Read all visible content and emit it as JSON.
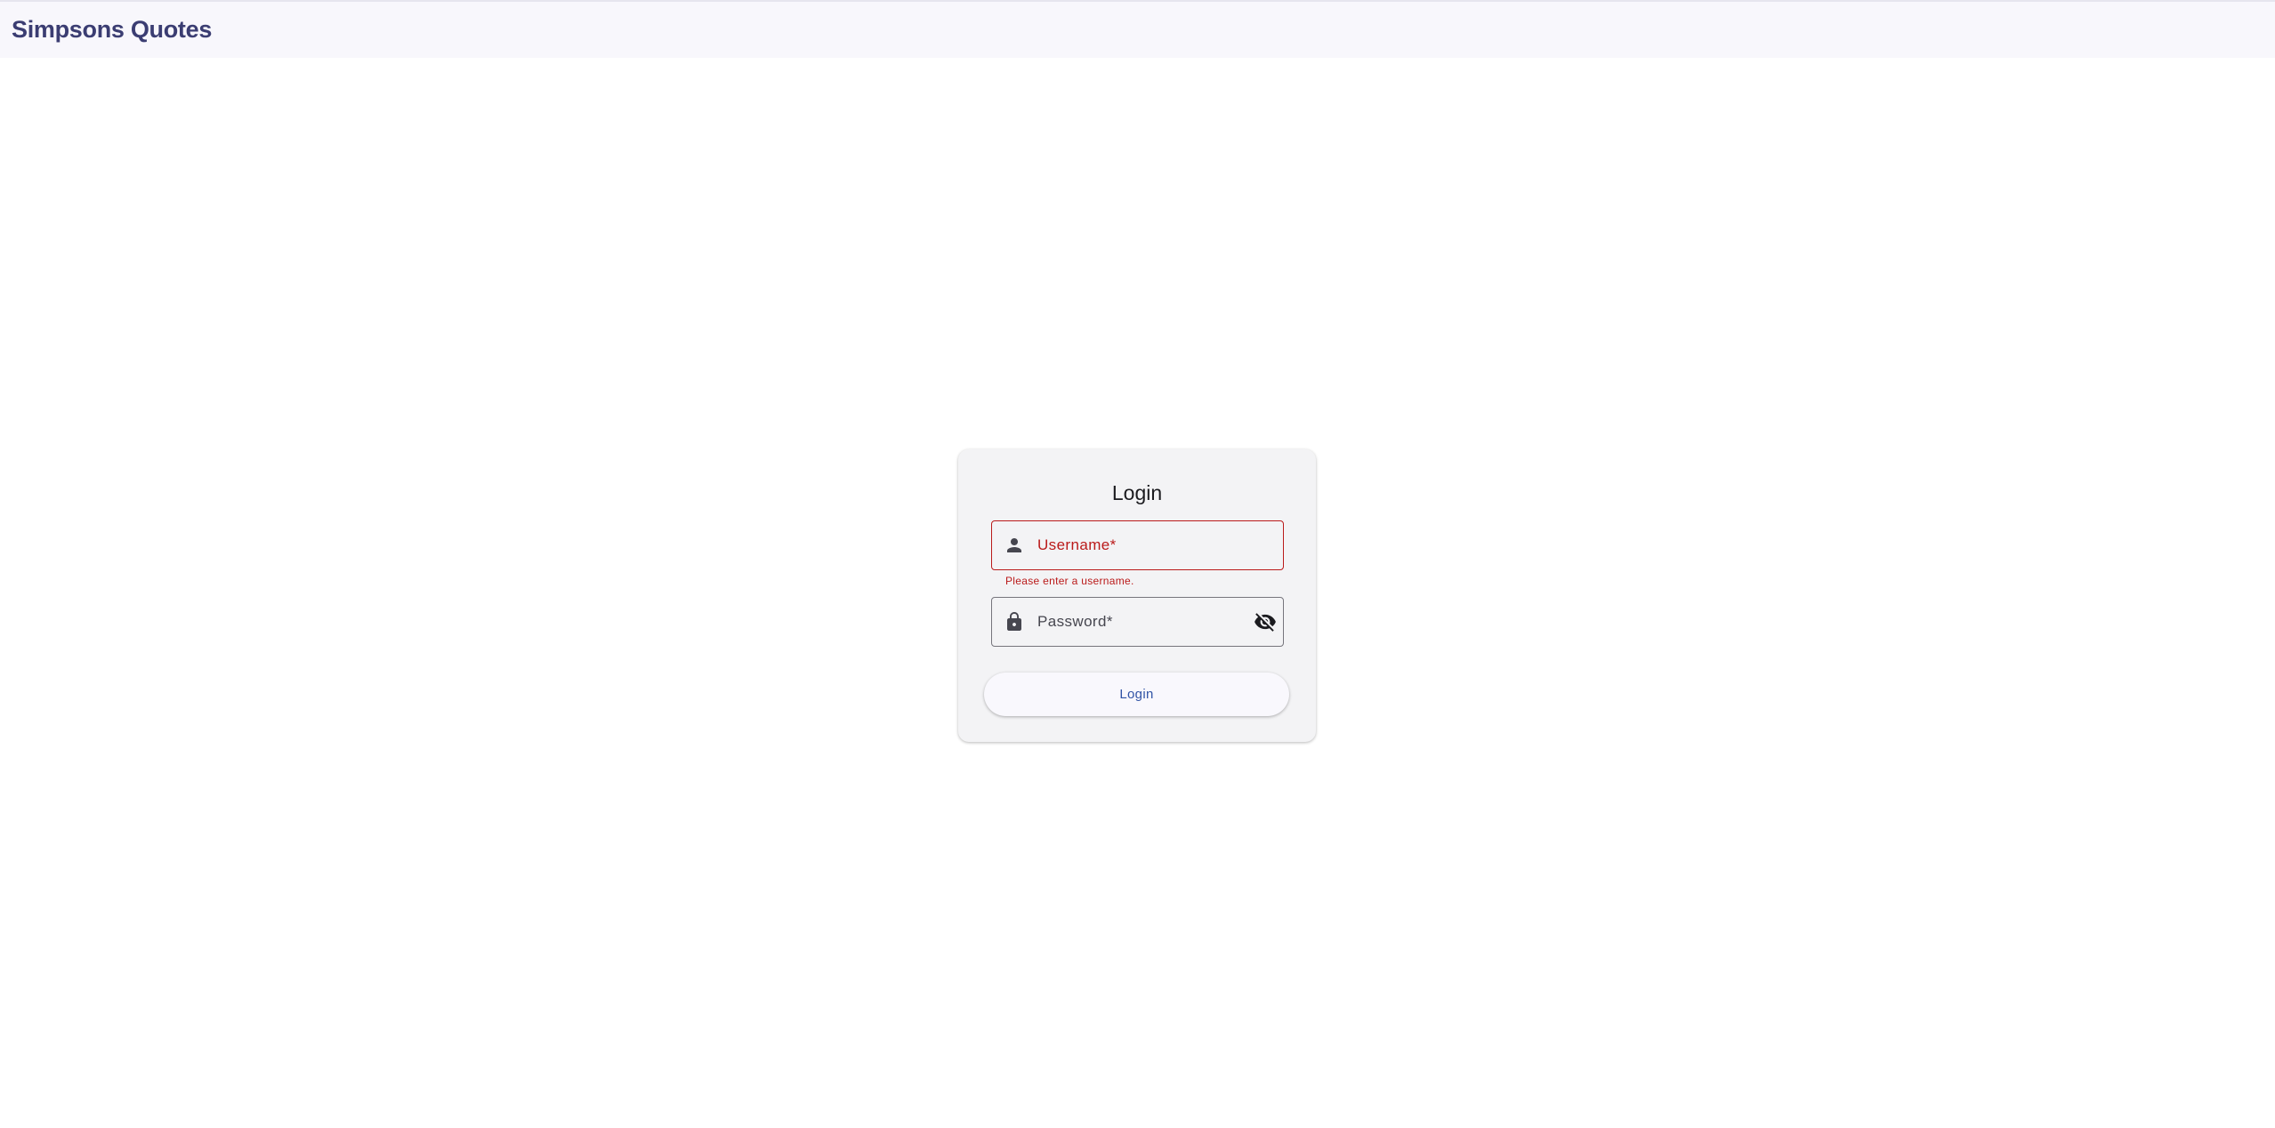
{
  "app": {
    "title": "Simpsons Quotes"
  },
  "login_card": {
    "title": "Login",
    "username": {
      "label": "Username*",
      "icon": "person-icon",
      "error": "Please enter a username."
    },
    "password": {
      "label": "Password*",
      "icon": "lock-icon",
      "toggle_icon": "visibility-off-icon"
    },
    "submit_label": "Login"
  },
  "colors": {
    "brand_title": "#3b3d72",
    "error": "#ba1a1a",
    "button_text": "#3154a6",
    "card_bg": "#f3f3f5",
    "app_bar_bg": "#f8f7fc"
  }
}
